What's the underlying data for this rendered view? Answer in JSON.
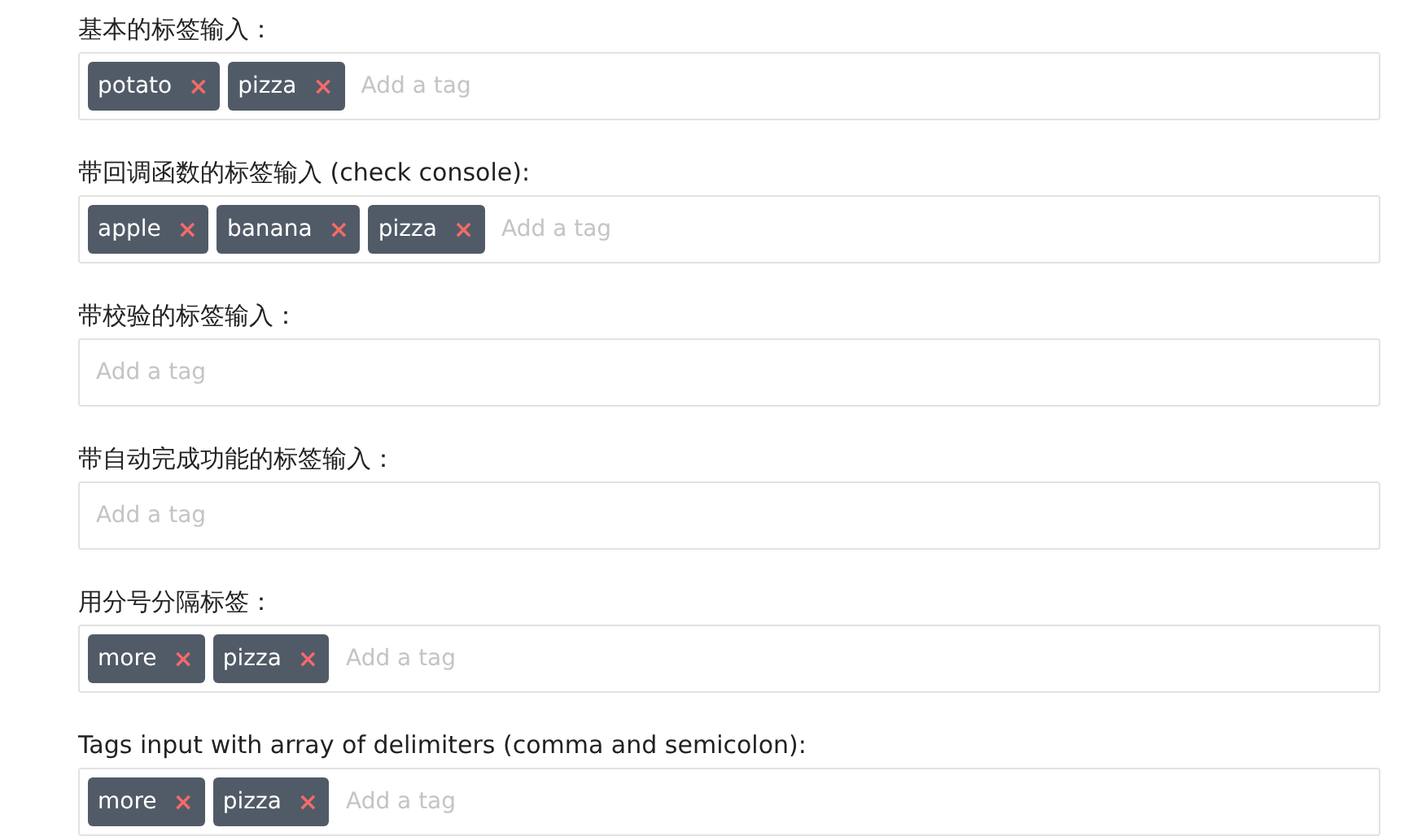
{
  "sections": [
    {
      "label": "基本的标签输入：",
      "tags": [
        {
          "text": "potato",
          "remove": "×"
        },
        {
          "text": "pizza",
          "remove": "×"
        }
      ],
      "placeholder": "Add a tag"
    },
    {
      "label": "带回调函数的标签输入 (check console):",
      "tags": [
        {
          "text": "apple",
          "remove": "×"
        },
        {
          "text": "banana",
          "remove": "×"
        },
        {
          "text": "pizza",
          "remove": "×"
        }
      ],
      "placeholder": "Add a tag"
    },
    {
      "label": "带校验的标签输入：",
      "placeholder": "Add a tag"
    },
    {
      "label": "带自动完成功能的标签输入：",
      "placeholder": "Add a tag"
    },
    {
      "label": "用分号分隔标签：",
      "tags": [
        {
          "text": "more",
          "remove": "×"
        },
        {
          "text": "pizza",
          "remove": "×"
        }
      ],
      "placeholder": "Add a tag"
    },
    {
      "label": "Tags input with array of delimiters (comma and semicolon):",
      "tags": [
        {
          "text": "more",
          "remove": "×"
        },
        {
          "text": "pizza",
          "remove": "×"
        }
      ],
      "placeholder": "Add a tag"
    }
  ]
}
